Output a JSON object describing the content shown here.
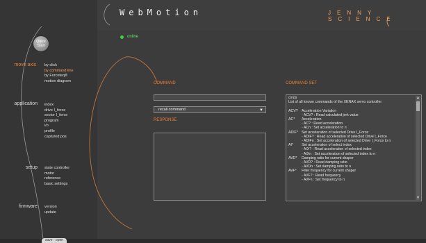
{
  "header": {
    "logo": "WebMotion",
    "brand": "JENNY SCIENCE"
  },
  "quickstart": "Quick Start",
  "status": {
    "label": "online",
    "color": "#3ecf3e"
  },
  "nav": [
    {
      "label": "move axis",
      "active": true,
      "items": [
        "by click",
        "by command line",
        "by Forceteq®",
        "motion diagram"
      ],
      "selected": 1
    },
    {
      "label": "application",
      "active": false,
      "items": [
        "index",
        "drive I_force",
        "sector I_force",
        "program",
        "i/o",
        "profile",
        "captured pos"
      ]
    },
    {
      "label": "setup",
      "active": false,
      "items": [
        "state controller",
        "motor",
        "reference",
        "basic settings"
      ]
    },
    {
      "label": "firmware",
      "active": false,
      "items": [
        "version",
        "update"
      ]
    }
  ],
  "save_open": "save · open",
  "command": {
    "label": "COMMAND",
    "input_value": "",
    "recall_label": "recall command",
    "response_label": "RESPONSE"
  },
  "command_set": {
    "label": "COMMAND SET",
    "lines": [
      {
        "code": "cmds",
        "text": ""
      },
      {
        "code": "",
        "text": "List of all known commands of the XENAX servo controller",
        "full": true
      },
      {
        "code": "",
        "text": ""
      },
      {
        "code": "ACV?",
        "text": "Acceleration Variation"
      },
      {
        "code": "",
        "text": "- ACV? : Read calculated jerk value",
        "indent": true
      },
      {
        "code": "AC*",
        "text": "Acceleration"
      },
      {
        "code": "",
        "text": "- AC? : Read acceleration",
        "indent": true
      },
      {
        "code": "",
        "text": "- ACn : Set acceleration to n",
        "indent": true
      },
      {
        "code": "ADIF*",
        "text": "Set acceleration of selected Drive I_Force"
      },
      {
        "code": "",
        "text": "- ADIF? : Read acceleration of selected Drive I_Force",
        "indent": true
      },
      {
        "code": "",
        "text": "- ADIFn : Set acceleration of selected Drive I_Force to n",
        "indent": true
      },
      {
        "code": "AI*",
        "text": "Set acceleration of select index"
      },
      {
        "code": "",
        "text": "- AIX? : Read acceleration of selected index",
        "indent": true
      },
      {
        "code": "",
        "text": "- AIXn : Set acceleration of selected index to n",
        "indent": true
      },
      {
        "code": "AVD*",
        "text": "Damping ratio for current shaper"
      },
      {
        "code": "",
        "text": "- AVD? : Read damping ratio",
        "indent": true
      },
      {
        "code": "",
        "text": "- AVDn : Set damping ratio to n",
        "indent": true
      },
      {
        "code": "AVF*",
        "text": "Filter frequency for current shaper"
      },
      {
        "code": "",
        "text": "- AVF? : Read frequency",
        "indent": true
      },
      {
        "code": "",
        "text": "- AVFn : Set frequency to n",
        "indent": true
      }
    ]
  },
  "colors": {
    "accent": "#f08030",
    "bg": "#3c3c3c"
  }
}
